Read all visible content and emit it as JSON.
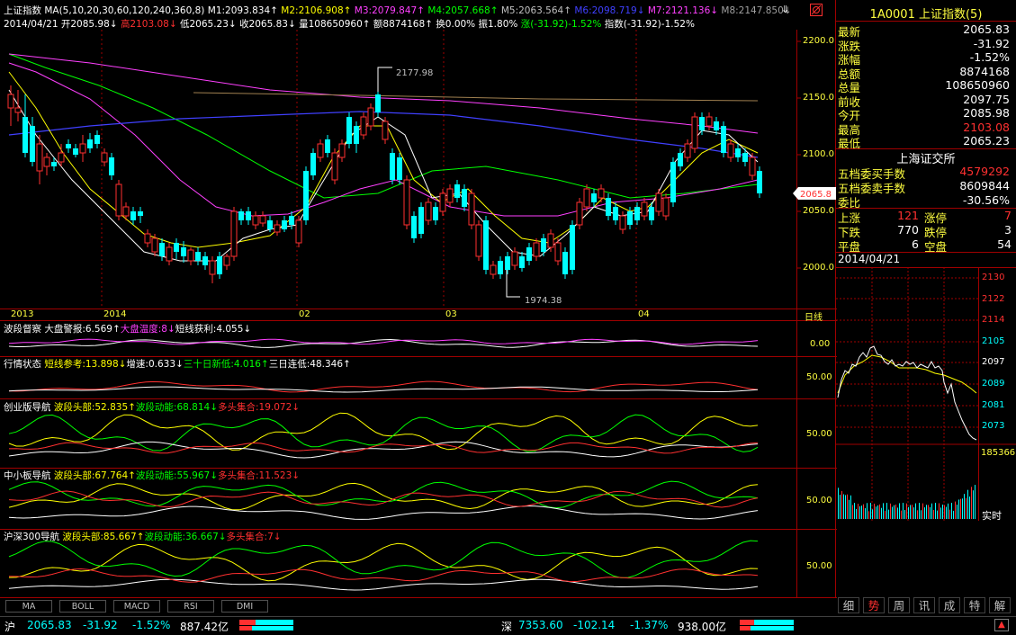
{
  "header": {
    "index_name": "上证指数",
    "ma_params": "MA(5,10,20,30,60,120,240,360,8)",
    "ma_values": [
      {
        "label": "M1:2093.834↑",
        "color": "#ffffff"
      },
      {
        "label": "M2:2106.908↑",
        "color": "#ffff00"
      },
      {
        "label": "M3:2079.847↑",
        "color": "#ff40ff"
      },
      {
        "label": "M4:2057.668↑",
        "color": "#00ff00"
      },
      {
        "label": "M5:2063.564↑",
        "color": "#c0c0c0"
      },
      {
        "label": "M6:2098.719↓",
        "color": "#4040ff"
      },
      {
        "label": "M7:2121.136↓",
        "color": "#ff40ff"
      },
      {
        "label": "M8:2147.850↓",
        "color": "#a0a0a0"
      }
    ],
    "info_date": "2014/04/21",
    "info_open": "开2085.98↓",
    "info_high": "高2103.08↓",
    "info_low": "低2065.23↓",
    "info_close": "收2065.83↓",
    "info_volume": "量108650960↑",
    "info_amount": "额8874168↑",
    "info_turnover": "换0.00%",
    "info_amplitude": "振1.80%",
    "info_change": "涨(-31.92)-1.52%",
    "info_index": "指数(-31.92)-1.52%"
  },
  "main_chart": {
    "price_axis": [
      "2200.0",
      "2150.0",
      "2100.0",
      "2050.0",
      "2000.0"
    ],
    "current_price_tag": "2065.8",
    "annotation_high": "2177.98",
    "annotation_low": "1974.38",
    "date_axis": [
      "2013",
      "2014",
      "02",
      "03",
      "04"
    ],
    "period_label": "日线"
  },
  "indicators": [
    {
      "title": "波段督察",
      "parts": [
        {
          "t": "大盘警报:6.569↑",
          "c": "#ffffff"
        },
        {
          "t": "大盘温度:8↓",
          "c": "#ff40ff"
        },
        {
          "t": "短线获利:4.055↓",
          "c": "#ffffff"
        }
      ],
      "axis": "0.00"
    },
    {
      "title": "行情状态",
      "parts": [
        {
          "t": "短线参考:13.898↓",
          "c": "#ffff00"
        },
        {
          "t": "增速:0.633↓",
          "c": "#ffffff"
        },
        {
          "t": "三十日新低:4.016↑",
          "c": "#00ff00"
        },
        {
          "t": "三日连低:48.346↑",
          "c": "#ffffff"
        }
      ],
      "axis": "50.00"
    },
    {
      "title": "创业版导航",
      "parts": [
        {
          "t": "波段头部:52.835↑",
          "c": "#ffff00"
        },
        {
          "t": "波段动能:68.814↓",
          "c": "#00ff00"
        },
        {
          "t": "多头集合:19.072↓",
          "c": "#ff3030"
        }
      ],
      "axis": "50.00"
    },
    {
      "title": "中小板导航",
      "parts": [
        {
          "t": "波段头部:67.764↑",
          "c": "#ffff00"
        },
        {
          "t": "波段动能:55.967↓",
          "c": "#00ff00"
        },
        {
          "t": "多头集合:11.523↓",
          "c": "#ff3030"
        }
      ],
      "axis": "50.00"
    },
    {
      "title": "沪深300导航",
      "parts": [
        {
          "t": "波段头部:85.667↑",
          "c": "#ffff00"
        },
        {
          "t": "波段动能:36.667↓",
          "c": "#00ff00"
        },
        {
          "t": "多头集合:7↓",
          "c": "#ff3030"
        }
      ],
      "axis": "50.00"
    }
  ],
  "bottom_tabs": [
    "MA",
    "BOLL",
    "MACD",
    "RSI",
    "DMI"
  ],
  "quote_panel": {
    "code_title": "1A0001 上证指数(5)",
    "rows": [
      {
        "k": "最新",
        "v": "2065.83",
        "c": "#ffffff"
      },
      {
        "k": "涨跌",
        "v": "-31.92",
        "c": "#ffffff"
      },
      {
        "k": "涨幅",
        "v": "-1.52%",
        "c": "#ffffff"
      },
      {
        "k": "总额",
        "v": "8874168",
        "c": "#ffffff"
      },
      {
        "k": "总量",
        "v": "108650960",
        "c": "#ffffff"
      },
      {
        "k": "前收",
        "v": "2097.75",
        "c": "#ffffff"
      },
      {
        "k": "今开",
        "v": "2085.98",
        "c": "#ffffff"
      },
      {
        "k": "最高",
        "v": "2103.08",
        "c": "#ff3030"
      },
      {
        "k": "最低",
        "v": "2065.23",
        "c": "#ffffff"
      }
    ],
    "exchange": "上海证交所",
    "rows2": [
      {
        "k": "五档委买手数",
        "v": "4579292",
        "c": "#ff3030"
      },
      {
        "k": "五档委卖手数",
        "v": "8609844",
        "c": "#ffffff"
      },
      {
        "k": "委比",
        "v": "-30.56%",
        "c": "#ffffff"
      }
    ],
    "stats": {
      "up_label": "上涨",
      "up_val": "121",
      "limit_up_label": "涨停",
      "limit_up_val": "7",
      "down_label": "下跌",
      "down_val": "770",
      "limit_down_label": "跌停",
      "limit_down_val": "3",
      "flat_label": "平盘",
      "flat_val": "6",
      "suspend_label": "空盘",
      "suspend_val": "54"
    },
    "mini_date": "2014/04/21",
    "mini_price_axis": [
      "2130",
      "2122",
      "2114",
      "2105",
      "2097",
      "2089",
      "2081",
      "2073"
    ],
    "mini_volume": "185366",
    "mini_label": "实时",
    "right_tabs": [
      "细",
      "势",
      "周",
      "讯",
      "成",
      "特",
      "解"
    ],
    "active_tab": "势"
  },
  "status_bar": {
    "sh_label": "沪",
    "sh_price": "2065.83",
    "sh_change": "-31.92",
    "sh_pct": "-1.52%",
    "sh_amount": "887.42亿",
    "sz_label": "深",
    "sz_price": "7353.60",
    "sz_change": "-102.14",
    "sz_pct": "-1.37%",
    "sz_amount": "938.00亿"
  },
  "colors": {
    "up": "#ff3030",
    "down": "#00ffff",
    "border": "#a00000",
    "axis": "#ffff40"
  }
}
